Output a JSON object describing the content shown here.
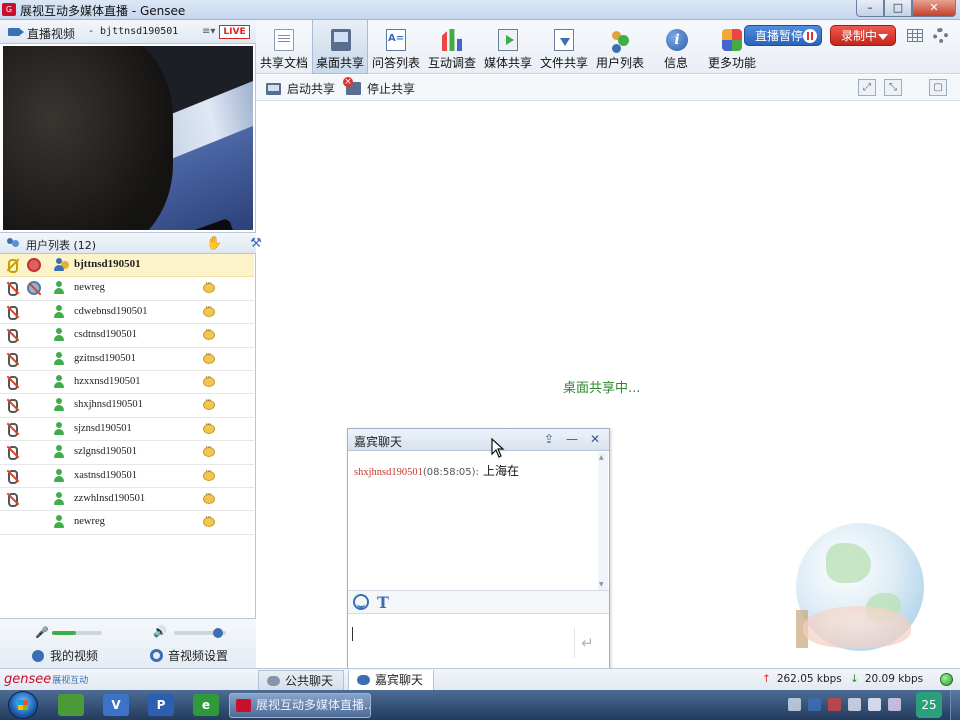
{
  "window": {
    "title": "展视互动多媒体直播 - Gensee",
    "controls": [
      "–",
      "□",
      "✕"
    ]
  },
  "video_panel": {
    "label": "直播视频",
    "presenter": "- bjttnsd190501",
    "live_badge": "LIVE"
  },
  "user_list": {
    "title": "用户列表 (12)",
    "users": [
      {
        "name": "bjttnsd190501",
        "role": "host",
        "selected": true
      },
      {
        "name": "newreg",
        "role": "attendee",
        "cam_disabled": true
      },
      {
        "name": "cdwebnsd190501",
        "role": "attendee"
      },
      {
        "name": "csdtnsd190501",
        "role": "attendee"
      },
      {
        "name": "gzitnsd190501",
        "role": "attendee"
      },
      {
        "name": "hzxxnsd190501",
        "role": "attendee"
      },
      {
        "name": "shxjhnsd190501",
        "role": "attendee"
      },
      {
        "name": "sjznsd190501",
        "role": "attendee"
      },
      {
        "name": "szlgnsd190501",
        "role": "attendee"
      },
      {
        "name": "xastnsd190501",
        "role": "attendee"
      },
      {
        "name": "zzwhlnsd190501",
        "role": "attendee"
      },
      {
        "name": "newreg",
        "role": "attendee",
        "no_mic_icon": true
      }
    ]
  },
  "left_footer": {
    "mic_level": 0.48,
    "speaker_level": 0.85,
    "my_video_label": "我的视频",
    "av_settings_label": "音视频设置"
  },
  "toolbar": {
    "tools": [
      {
        "label": "共享文档",
        "icon": "document-icon"
      },
      {
        "label": "桌面共享",
        "icon": "desktop-share-icon",
        "active": true
      },
      {
        "label": "问答列表",
        "icon": "qa-list-icon"
      },
      {
        "label": "互动调查",
        "icon": "survey-chart-icon"
      },
      {
        "label": "媒体共享",
        "icon": "media-share-icon"
      },
      {
        "label": "文件共享",
        "icon": "file-share-icon"
      },
      {
        "label": "用户列表",
        "icon": "user-list-icon"
      },
      {
        "label": "信息",
        "icon": "info-icon"
      },
      {
        "label": "更多功能",
        "icon": "more-functions-icon"
      }
    ],
    "pause_live_label": "直播暂停",
    "recording_label": "录制中"
  },
  "subbar": {
    "start_share_label": "启动共享",
    "stop_share_label": "停止共享",
    "fit_icons": [
      "fit-window-icon",
      "actual-size-icon",
      "fullscreen-icon"
    ]
  },
  "main": {
    "share_status": "桌面共享中..."
  },
  "guest_chat": {
    "title": "嘉宾聊天",
    "messages": [
      {
        "from": "shxjhnsd190501",
        "time": "(08:58:05):",
        "text": "上海在"
      }
    ]
  },
  "bottom_bar": {
    "logo_text": "gensee",
    "logo_sub": "展视互动",
    "public_chat_tab": "公共聊天",
    "guest_chat_tab": "嘉宾聊天",
    "upload_speed": "262.05 kbps",
    "download_speed": "20.09 kbps"
  },
  "taskbar": {
    "pinned": [
      {
        "label": "",
        "icon": "app-icon",
        "color": "#4a9a3a"
      },
      {
        "label": "V",
        "icon": "v-app-icon",
        "color": "#3b73c7"
      },
      {
        "label": "P",
        "icon": "p-app-icon",
        "color": "#2d5fb0"
      },
      {
        "label": "e",
        "icon": "browser-icon",
        "color": "#2f9a3a"
      }
    ],
    "task_label": "展视互动多媒体直播...",
    "tray_badge": "25"
  }
}
